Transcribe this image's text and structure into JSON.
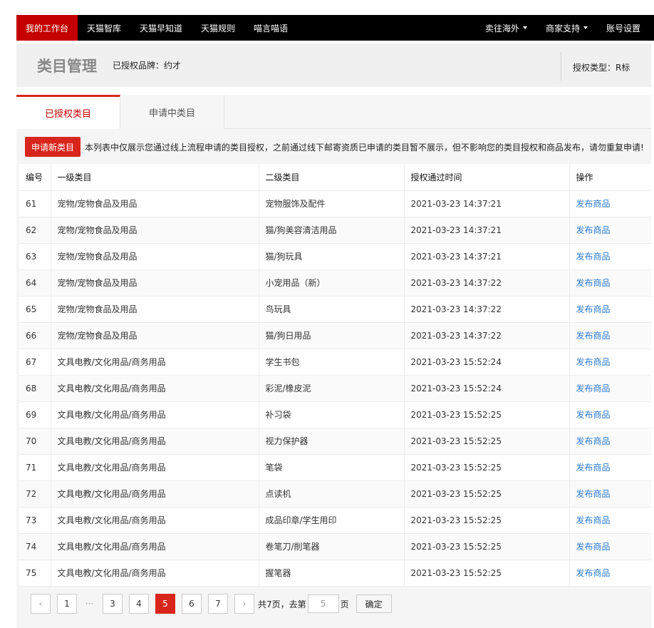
{
  "topnav": {
    "left": [
      "我的工作台",
      "天猫智库",
      "天猫早知道",
      "天猫规则",
      "喵言喵语"
    ],
    "right": [
      {
        "label": "卖往海外",
        "caret": true
      },
      {
        "label": "商家支持",
        "caret": true
      },
      {
        "label": "账号设置",
        "caret": false
      }
    ]
  },
  "header": {
    "title": "类目管理",
    "brand": "已授权品牌：约才",
    "auth_type": "授权类型：R标"
  },
  "tabs": [
    "已授权类目",
    "申请中类目"
  ],
  "apply_button": "申请新类目",
  "notice": "本列表中仅展示您通过线上流程申请的类目授权，之前通过线下邮寄资质已申请的类目暂不展示，但不影响您的类目授权和商品发布，请勿重复申请!",
  "table": {
    "headers": [
      "编号",
      "一级类目",
      "二级类目",
      "授权通过时间",
      "操作"
    ],
    "rows": [
      [
        "61",
        "宠物/宠物食品及用品",
        "宠物服饰及配件",
        "2021-03-23 14:37:21",
        "发布商品"
      ],
      [
        "62",
        "宠物/宠物食品及用品",
        "猫/狗美容清洁用品",
        "2021-03-23 14:37:21",
        "发布商品"
      ],
      [
        "63",
        "宠物/宠物食品及用品",
        "猫/狗玩具",
        "2021-03-23 14:37:21",
        "发布商品"
      ],
      [
        "64",
        "宠物/宠物食品及用品",
        "小宠用品（新）",
        "2021-03-23 14:37:22",
        "发布商品"
      ],
      [
        "65",
        "宠物/宠物食品及用品",
        "鸟玩具",
        "2021-03-23 14:37:22",
        "发布商品"
      ],
      [
        "66",
        "宠物/宠物食品及用品",
        "猫/狗日用品",
        "2021-03-23 14:37:22",
        "发布商品"
      ],
      [
        "67",
        "文具电教/文化用品/商务用品",
        "学生书包",
        "2021-03-23 15:52:24",
        "发布商品"
      ],
      [
        "68",
        "文具电教/文化用品/商务用品",
        "彩泥/橡皮泥",
        "2021-03-23 15:52:24",
        "发布商品"
      ],
      [
        "69",
        "文具电教/文化用品/商务用品",
        "补习袋",
        "2021-03-23 15:52:25",
        "发布商品"
      ],
      [
        "70",
        "文具电教/文化用品/商务用品",
        "视力保护器",
        "2021-03-23 15:52:25",
        "发布商品"
      ],
      [
        "71",
        "文具电教/文化用品/商务用品",
        "笔袋",
        "2021-03-23 15:52:25",
        "发布商品"
      ],
      [
        "72",
        "文具电教/文化用品/商务用品",
        "点读机",
        "2021-03-23 15:52:25",
        "发布商品"
      ],
      [
        "73",
        "文具电教/文化用品/商务用品",
        "成品印章/学生用印",
        "2021-03-23 15:52:25",
        "发布商品"
      ],
      [
        "74",
        "文具电教/文化用品/商务用品",
        "卷笔刀/削笔器",
        "2021-03-23 15:52:25",
        "发布商品"
      ],
      [
        "75",
        "文具电教/文化用品/商务用品",
        "握笔器",
        "2021-03-23 15:52:25",
        "发布商品"
      ]
    ]
  },
  "pagination": {
    "prev": "‹",
    "next": "›",
    "first": "1",
    "ellipsis": "···",
    "pages": [
      "3",
      "4",
      "5",
      "6",
      "7"
    ],
    "current": "5",
    "total_text": "共7页，去第",
    "input_value": "5",
    "unit": "页",
    "confirm": "确定"
  },
  "colors": {
    "accent": "#d9261c",
    "nav_bg": "#000000",
    "link": "#2a7bd3"
  }
}
